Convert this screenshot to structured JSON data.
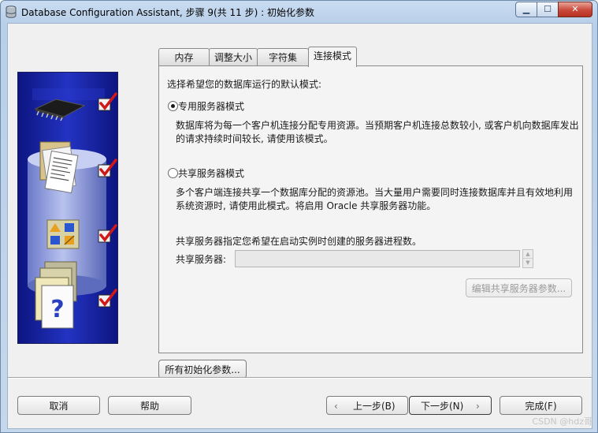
{
  "window": {
    "title": "Database Configuration Assistant, 步骤 9(共 11 步) : 初始化参数",
    "buttons": {
      "minimize": "▁",
      "maximize": "☐",
      "close": "✕"
    }
  },
  "tabs": [
    {
      "label": "内存",
      "active": false
    },
    {
      "label": "调整大小",
      "active": false
    },
    {
      "label": "字符集",
      "active": false
    },
    {
      "label": "连接模式",
      "active": true
    }
  ],
  "panel": {
    "heading": "选择希望您的数据库运行的默认模式:",
    "dedicated": {
      "label": "专用服务器模式",
      "selected": true,
      "desc_line1": "数据库将为每一个客户机连接分配专用资源。当预期客户机连接总数较小, 或客户机向数据库发出",
      "desc_line2": "的请求持续时间较长, 请使用该模式。"
    },
    "shared": {
      "label": "共享服务器模式",
      "selected": false,
      "desc_line1": "多个客户端连接共享一个数据库分配的资源池。当大量用户需要同时连接数据库并且有效地利用",
      "desc_line2": "系统资源时, 请使用此模式。将启用 Oracle 共享服务器功能。"
    },
    "shared_servers_note": "共享服务器指定您希望在启动实例时创建的服务器进程数。",
    "shared_servers_label": "共享服务器:",
    "shared_servers_value": "",
    "edit_shared_params_button": "编辑共享服务器参数..."
  },
  "all_init_params_button": "所有初始化参数...",
  "footer": {
    "cancel": "取消",
    "help": "帮助",
    "back": "上一步(B)",
    "next": "下一步(N)",
    "finish": "完成(F)"
  },
  "watermark": "CSDN @hdz哥",
  "colors": {
    "side_panel_bg": "#1c27a8",
    "check_red": "#d01818"
  }
}
